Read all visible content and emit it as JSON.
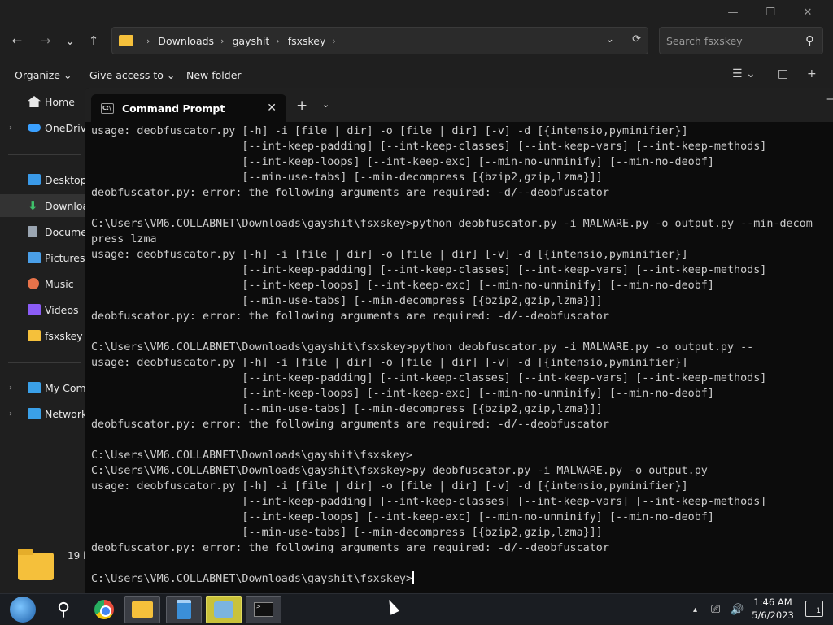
{
  "explorer": {
    "window_controls": {
      "minimize": "—",
      "maximize": "❐",
      "close": "✕"
    },
    "nav": {
      "back": "←",
      "forward": "→",
      "recent": "⌄",
      "up": "↑"
    },
    "address": {
      "crumbs": [
        "Downloads",
        "gayshit",
        "fsxskey"
      ],
      "sep": "›"
    },
    "search_placeholder": "Search fsxskey",
    "commands": {
      "organize": "Organize ⌄",
      "give_access": "Give access to ⌄",
      "new_folder": "New folder"
    },
    "sidebar": [
      {
        "label": "Home",
        "icon": "home-icon",
        "color": "#e8e8e8"
      },
      {
        "label": "OneDrive",
        "icon": "cloud-icon",
        "color": "#3aa0ff"
      },
      {
        "label": "Desktop",
        "icon": "desktop-icon",
        "color": "#3a9ae8"
      },
      {
        "label": "Downloads",
        "icon": "download-icon",
        "color": "#3fbf6a"
      },
      {
        "label": "Documents",
        "icon": "document-icon",
        "color": "#9aa5b1"
      },
      {
        "label": "Pictures",
        "icon": "picture-icon",
        "color": "#4a9fe8"
      },
      {
        "label": "Music",
        "icon": "music-icon",
        "color": "#e8734a"
      },
      {
        "label": "Videos",
        "icon": "video-icon",
        "color": "#8b5cf6"
      },
      {
        "label": "fsxskey",
        "icon": "folder-icon",
        "color": "#f5c03b"
      },
      {
        "label": "My Computer",
        "icon": "computer-icon",
        "color": "#3aa0e8"
      },
      {
        "label": "Network",
        "icon": "network-icon",
        "color": "#3aa0e8"
      }
    ],
    "item_count": "19 i"
  },
  "terminal": {
    "tab_title": "Command Prompt",
    "tab_icon_text": "C:\\_",
    "new_tab": "+",
    "tab_dropdown": "⌄",
    "minimize": "—",
    "lines": [
      "usage: deobfuscator.py [-h] -i [file | dir] -o [file | dir] [-v] -d [{intensio,pyminifier}]",
      "                       [--int-keep-padding] [--int-keep-classes] [--int-keep-vars] [--int-keep-methods]",
      "                       [--int-keep-loops] [--int-keep-exc] [--min-no-unminify] [--min-no-deobf]",
      "                       [--min-use-tabs] [--min-decompress [{bzip2,gzip,lzma}]]",
      "deobfuscator.py: error: the following arguments are required: -d/--deobfuscator",
      "",
      "C:\\Users\\VM6.COLLABNET\\Downloads\\gayshit\\fsxskey>python deobfuscator.py -i MALWARE.py -o output.py --min-decom",
      "press lzma",
      "usage: deobfuscator.py [-h] -i [file | dir] -o [file | dir] [-v] -d [{intensio,pyminifier}]",
      "                       [--int-keep-padding] [--int-keep-classes] [--int-keep-vars] [--int-keep-methods]",
      "                       [--int-keep-loops] [--int-keep-exc] [--min-no-unminify] [--min-no-deobf]",
      "                       [--min-use-tabs] [--min-decompress [{bzip2,gzip,lzma}]]",
      "deobfuscator.py: error: the following arguments are required: -d/--deobfuscator",
      "",
      "C:\\Users\\VM6.COLLABNET\\Downloads\\gayshit\\fsxskey>python deobfuscator.py -i MALWARE.py -o output.py --",
      "usage: deobfuscator.py [-h] -i [file | dir] -o [file | dir] [-v] -d [{intensio,pyminifier}]",
      "                       [--int-keep-padding] [--int-keep-classes] [--int-keep-vars] [--int-keep-methods]",
      "                       [--int-keep-loops] [--int-keep-exc] [--min-no-unminify] [--min-no-deobf]",
      "                       [--min-use-tabs] [--min-decompress [{bzip2,gzip,lzma}]]",
      "deobfuscator.py: error: the following arguments are required: -d/--deobfuscator",
      "",
      "C:\\Users\\VM6.COLLABNET\\Downloads\\gayshit\\fsxskey>",
      "C:\\Users\\VM6.COLLABNET\\Downloads\\gayshit\\fsxskey>py deobfuscator.py -i MALWARE.py -o output.py",
      "usage: deobfuscator.py [-h] -i [file | dir] -o [file | dir] [-v] -d [{intensio,pyminifier}]",
      "                       [--int-keep-padding] [--int-keep-classes] [--int-keep-vars] [--int-keep-methods]",
      "                       [--int-keep-loops] [--int-keep-exc] [--min-no-unminify] [--min-no-deobf]",
      "                       [--min-use-tabs] [--min-decompress [{bzip2,gzip,lzma}]]",
      "deobfuscator.py: error: the following arguments are required: -d/--deobfuscator",
      ""
    ],
    "prompt": "C:\\Users\\VM6.COLLABNET\\Downloads\\gayshit\\fsxskey>"
  },
  "taskbar": {
    "search_glyph": "⚲",
    "term_icon_text": ">_",
    "tray": {
      "arrow": "▴",
      "network": "⎚",
      "volume": "🔊"
    },
    "time": "1:46 AM",
    "date": "5/6/2023",
    "notifications": "1"
  }
}
